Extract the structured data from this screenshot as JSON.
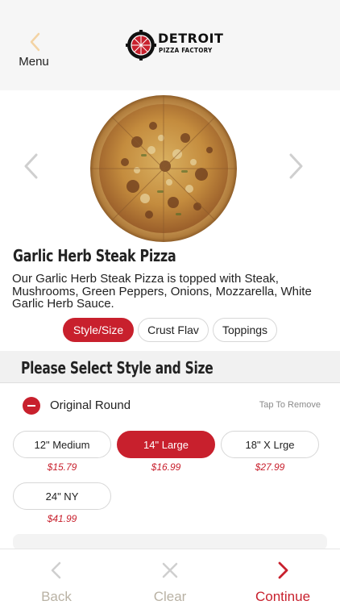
{
  "header": {
    "menu_label": "Menu",
    "logo_title": "DETROIT",
    "logo_subtitle": "PIZZA FACTORY"
  },
  "product": {
    "title": "Garlic Herb Steak Pizza",
    "description": "Our Garlic Herb Steak Pizza is topped with Steak, Mushrooms, Green Peppers, Onions, Mozzarella, White Garlic Herb Sauce."
  },
  "tabs": [
    {
      "label": "Style/Size",
      "active": true
    },
    {
      "label": "Crust Flav",
      "active": false
    },
    {
      "label": "Toppings",
      "active": false
    }
  ],
  "section": {
    "title": "Please Select Style and Size"
  },
  "option": {
    "name": "Original Round",
    "remove_hint": "Tap To Remove"
  },
  "sizes": [
    {
      "label": "12\" Medium",
      "price": "$15.79",
      "selected": false
    },
    {
      "label": "14\" Large",
      "price": "$16.99",
      "selected": true
    },
    {
      "label": "18\" X Lrge",
      "price": "$27.99",
      "selected": false
    },
    {
      "label": "24\" NY",
      "price": "$41.99",
      "selected": false
    }
  ],
  "bottom_bar": {
    "back_label": "Back",
    "clear_label": "Clear",
    "continue_label": "Continue"
  },
  "colors": {
    "accent": "#c8202d",
    "muted_label": "#b9b2a4",
    "chip_border": "#d7d7d7"
  }
}
